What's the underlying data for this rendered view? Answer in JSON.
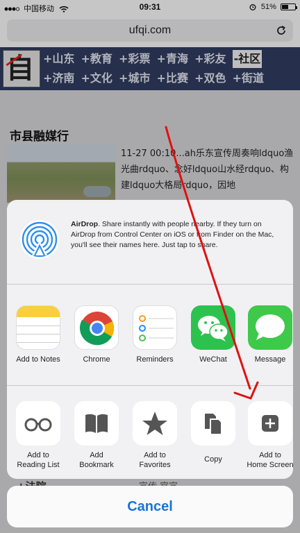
{
  "status_bar": {
    "carrier": "中国移动",
    "time": "09:31",
    "battery": "51%",
    "battery_level": 0.51
  },
  "browser": {
    "url": "ufqi.com",
    "reload_icon": "reload-icon"
  },
  "site_header": {
    "logo_char": "自",
    "nav_rows": [
      [
        "+山东",
        "+教育",
        "+彩票",
        "+青海",
        "+彩友",
        "-社区"
      ],
      [
        "+济南",
        "+文化",
        "+城市",
        "+比赛",
        "+双色",
        "+街道"
      ]
    ]
  },
  "page": {
    "section_title": "市县融媒行",
    "article_text": "11-27 00:10...ah乐东宣传周奏响ldquo渔光曲rdquo、念好ldquo山水经rdquo、构建ldquo大格局rdquo，因地",
    "bottom_left": "+法院",
    "bottom_right": "宣传 官宣"
  },
  "share_sheet": {
    "airdrop": {
      "title": "AirDrop",
      "description": ". Share instantly with people nearby. If they turn on AirDrop from Control Center on iOS or from Finder on the Mac, you'll see their names here. Just tap to share."
    },
    "apps": [
      {
        "label": "Add to Notes",
        "icon": "notes-icon"
      },
      {
        "label": "Chrome",
        "icon": "chrome-icon"
      },
      {
        "label": "Reminders",
        "icon": "reminders-icon"
      },
      {
        "label": "WeChat",
        "icon": "wechat-icon"
      },
      {
        "label": "Message",
        "icon": "message-icon"
      }
    ],
    "actions": [
      {
        "label_line1": "Add to",
        "label_line2": "Reading List",
        "icon": "glasses-icon"
      },
      {
        "label_line1": "Add",
        "label_line2": "Bookmark",
        "icon": "book-icon"
      },
      {
        "label_line1": "Add to",
        "label_line2": "Favorites",
        "icon": "star-icon"
      },
      {
        "label_line1": "Copy",
        "label_line2": "",
        "icon": "copy-icon"
      },
      {
        "label_line1": "Add to",
        "label_line2": "Home Screen",
        "icon": "add-square-icon"
      }
    ],
    "cancel": "Cancel"
  },
  "colors": {
    "accent_blue": "#1a73d9",
    "header_bg": "#2f3a5c",
    "annotation_red": "#e01010"
  }
}
